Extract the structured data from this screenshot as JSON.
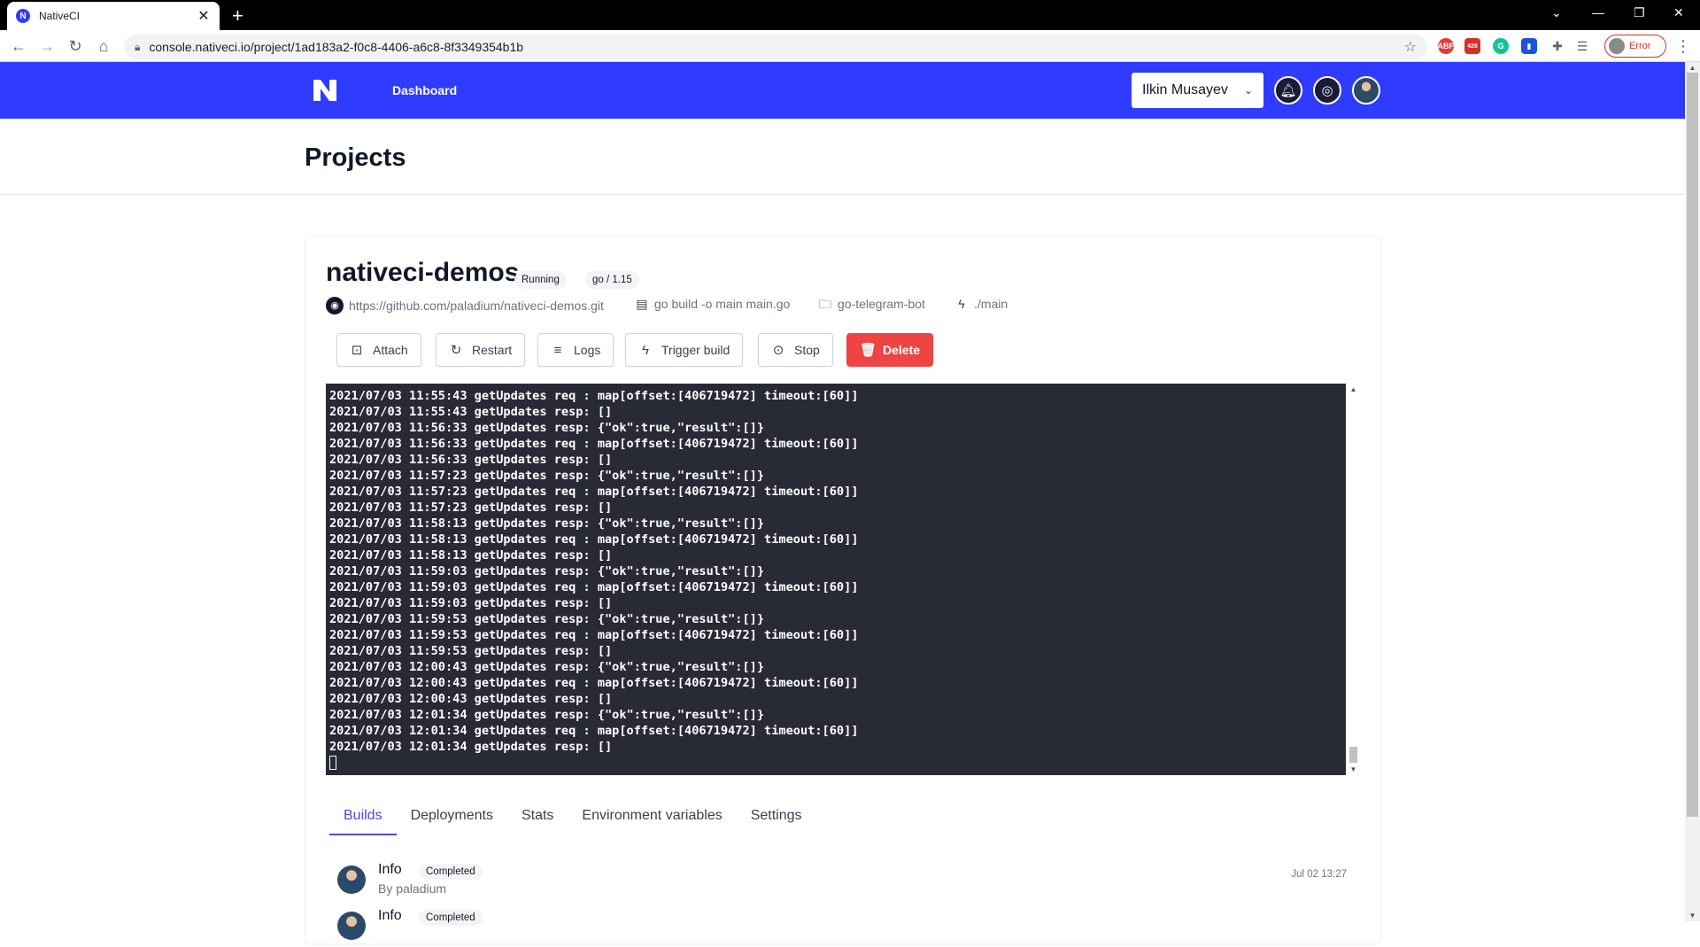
{
  "browser": {
    "tab_title": "NativeCI",
    "tab_favicon": "N",
    "url": "console.nativeci.io/project/1ad183a2-f0c8-4406-a6c8-8f3349354b1b",
    "profile_label": "Error",
    "ext_badge_count": "426"
  },
  "appbar": {
    "nav_dashboard": "Dashboard",
    "user_name": "Ilkin Musayev",
    "brand_color": "#2f3cff"
  },
  "page": {
    "title": "Projects"
  },
  "project": {
    "name": "nativeci-demos",
    "badges": [
      "Running",
      "go / 1.15"
    ],
    "repo_url": "https://github.com/paladium/nativeci-demos.git",
    "build_command": "go build -o main main.go",
    "directory": "go-telegram-bot",
    "run_command": "./main"
  },
  "actions": {
    "attach": "Attach",
    "restart": "Restart",
    "logs": "Logs",
    "trigger_build": "Trigger build",
    "stop": "Stop",
    "delete": "Delete",
    "delete_color": "#ef4444"
  },
  "terminal": {
    "lines": [
      "2021/07/03 11:55:43 getUpdates req : map[offset:[406719472] timeout:[60]]",
      "2021/07/03 11:55:43 getUpdates resp: []",
      "2021/07/03 11:56:33 getUpdates resp: {\"ok\":true,\"result\":[]}",
      "2021/07/03 11:56:33 getUpdates req : map[offset:[406719472] timeout:[60]]",
      "2021/07/03 11:56:33 getUpdates resp: []",
      "2021/07/03 11:57:23 getUpdates resp: {\"ok\":true,\"result\":[]}",
      "2021/07/03 11:57:23 getUpdates req : map[offset:[406719472] timeout:[60]]",
      "2021/07/03 11:57:23 getUpdates resp: []",
      "2021/07/03 11:58:13 getUpdates resp: {\"ok\":true,\"result\":[]}",
      "2021/07/03 11:58:13 getUpdates req : map[offset:[406719472] timeout:[60]]",
      "2021/07/03 11:58:13 getUpdates resp: []",
      "2021/07/03 11:59:03 getUpdates resp: {\"ok\":true,\"result\":[]}",
      "2021/07/03 11:59:03 getUpdates req : map[offset:[406719472] timeout:[60]]",
      "2021/07/03 11:59:03 getUpdates resp: []",
      "2021/07/03 11:59:53 getUpdates resp: {\"ok\":true,\"result\":[]}",
      "2021/07/03 11:59:53 getUpdates req : map[offset:[406719472] timeout:[60]]",
      "2021/07/03 11:59:53 getUpdates resp: []",
      "2021/07/03 12:00:43 getUpdates resp: {\"ok\":true,\"result\":[]}",
      "2021/07/03 12:00:43 getUpdates req : map[offset:[406719472] timeout:[60]]",
      "2021/07/03 12:00:43 getUpdates resp: []",
      "2021/07/03 12:01:34 getUpdates resp: {\"ok\":true,\"result\":[]}",
      "2021/07/03 12:01:34 getUpdates req : map[offset:[406719472] timeout:[60]]",
      "2021/07/03 12:01:34 getUpdates resp: []"
    ],
    "background": "#282a36"
  },
  "tabs": [
    "Builds",
    "Deployments",
    "Stats",
    "Environment variables",
    "Settings"
  ],
  "active_tab": "Builds",
  "builds": [
    {
      "title": "Info",
      "status": "Completed",
      "by": "By paladium",
      "time": "Jul 02 13:27"
    },
    {
      "title": "Info",
      "status": "Completed",
      "by": "",
      "time": ""
    }
  ]
}
